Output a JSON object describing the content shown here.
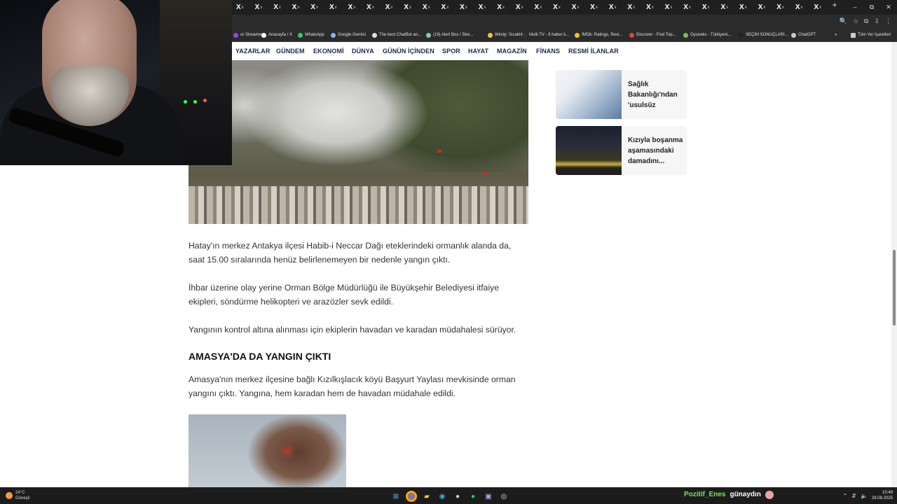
{
  "browser": {
    "tabs": [
      "X",
      "X",
      "X",
      "X",
      "X",
      "X",
      "X",
      "X",
      "X",
      "X",
      "X",
      "X",
      "X",
      "X",
      "X",
      "X",
      "X",
      "X",
      "X",
      "X",
      "X",
      "X",
      "X",
      "X",
      "X",
      "X",
      "X",
      "X",
      "X",
      "X",
      "X",
      "X"
    ],
    "tab_suffix": "x",
    "new_tab": "+",
    "window_controls": {
      "minimize": "–",
      "restore": "⧉",
      "close": "✕"
    },
    "toolbar_icons": [
      "zoom-icon",
      "star-icon",
      "extensions-icon",
      "menu-icon"
    ],
    "bookmarks": [
      {
        "label": "or Streamers",
        "icon": "twitch-icon"
      },
      {
        "label": "Anasayfa / X",
        "icon": "x-icon"
      },
      {
        "label": "WhatsApp",
        "icon": "whatsapp-icon"
      },
      {
        "label": "Google Gemini",
        "icon": "gemini-icon"
      },
      {
        "label": "The best ChatBot an...",
        "icon": "chatbot-icon"
      },
      {
        "label": "(19) Alert Box / Stre...",
        "icon": "streamlabs-icon"
      },
      {
        "label": "Windy: Sıcaklık",
        "icon": "windy-icon"
      },
      {
        "label": "Multi TV - 6 haber k...",
        "icon": "tv-icon"
      },
      {
        "label": "IMDb: Ratings, Revi...",
        "icon": "imdb-icon"
      },
      {
        "label": "Discover - Find Top...",
        "icon": "discover-icon"
      },
      {
        "label": "Oyuneks - Türkiyeni...",
        "icon": "oyuneks-icon"
      },
      {
        "label": "SEÇİM SONUÇLARI...",
        "icon": "election-icon"
      },
      {
        "label": "ChatGPT",
        "icon": "chatgpt-icon"
      }
    ],
    "bookmarks_overflow": "»",
    "all_bookmarks": "Tüm Yer İşaretleri"
  },
  "site_nav": [
    "YAZARLAR",
    "GÜNDEM",
    "EKONOMİ",
    "DÜNYA",
    "GÜNÜN İÇİNDEN",
    "SPOR",
    "HAYAT",
    "MAGAZİN",
    "FİNANS",
    "RESMİ İLANLAR"
  ],
  "article": {
    "paragraphs": [
      "Hatay'ın merkez Antakya ilçesi Habib-i Neccar Dağı eteklerindeki ormanlık alanda da, saat 15.00 sıralarında henüz belirlenemeyen bir nedenle yangın çıktı.",
      "İhbar üzerine olay yerine Orman Bölge Müdürlüğü ile Büyükşehir Belediyesi itfaiye ekipleri, söndürme helikopteri ve arazözler sevk edildi.",
      "Yangının kontrol altına alınması için ekiplerin havadan ve karadan müdahalesi sürüyor."
    ],
    "subheading": "AMASYA'DA DA YANGIN ÇIKTI",
    "paragraph_amasya": "Amasya'nın merkez ilçesine bağlı Kızılkışlacık köyü Başyurt Yaylası mevkisinde orman yangını çıktı. Yangına, hem karadan hem de havadan müdahale edildi."
  },
  "sidebar_cards": [
    {
      "title": "Sağlık Bakanlığı'ndan 'usulsüz randevu..."
    },
    {
      "title": "Kızıyla boşanma aşamasındaki damadını..."
    }
  ],
  "taskbar": {
    "weather_temp": "24°C",
    "weather_desc": "Güneşli",
    "chat_user": "Pozitif_Enes",
    "chat_message": "günaydın",
    "time": "10:49",
    "date": "29.08.2025"
  }
}
